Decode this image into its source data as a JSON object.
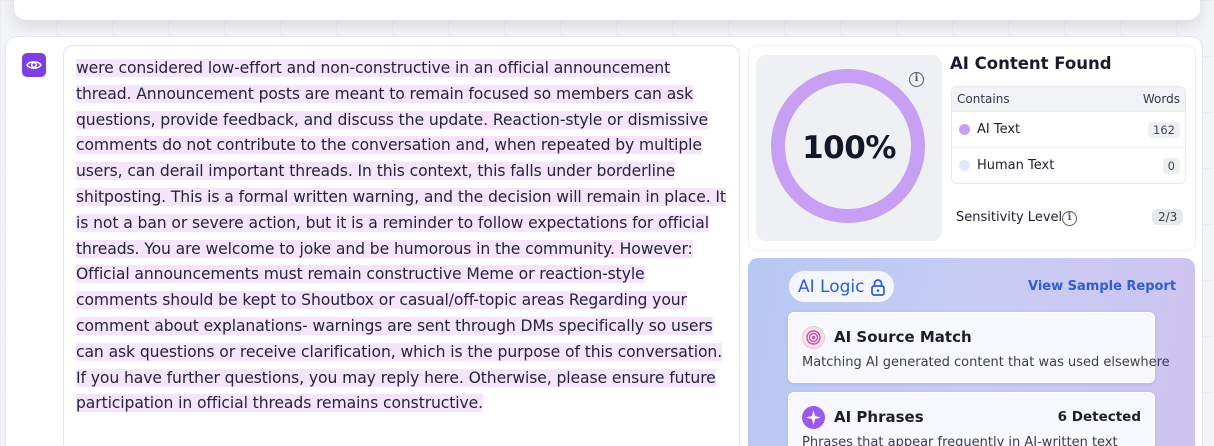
{
  "colors": {
    "accent_purple": "#7b3fe4",
    "ai_text_highlight": "#f5e4fb",
    "ring_ai": "#c7a0f4",
    "human_dot": "#e1e8f9",
    "logic_blue": "#2d5bdc"
  },
  "toolbar": {
    "eye_icon": "eye-icon"
  },
  "document": {
    "text": "were considered low-effort and non-constructive in an official announcement thread. Announcement posts are meant to remain focused so members can ask questions, provide feedback, and discuss the update. Reaction-style or dismissive comments do not contribute to the conversation and, when repeated by multiple users, can derail important threads. In this context, this falls under borderline shitposting. This is a formal written warning, and the decision will remain in place. It is not a ban or severe action, but it is a reminder to follow expectations for official threads. You are welcome to joke and be humorous in the community. However: Official announcements must remain constructive Meme or reaction-style comments should be kept to Shoutbox or casual/off-topic areas Regarding your comment about explanations- warnings are sent through DMs specifically so users can ask questions or receive clarification, which is the purpose of this conversation. If you have further questions, you may reply here. Otherwise, please ensure future participation in official threads remains constructive."
  },
  "result": {
    "percentage": "100%",
    "percentage_value": 100,
    "title": "AI Content Found",
    "table": {
      "col_contains": "Contains",
      "col_words": "Words",
      "rows": [
        {
          "label": "AI Text",
          "count": "162"
        },
        {
          "label": "Human Text",
          "count": "0"
        }
      ]
    },
    "sensitivity_label": "Sensitivity Level",
    "sensitivity_value": "2/3"
  },
  "ai_logic": {
    "title": "AI Logic",
    "sample_link": "View Sample Report",
    "cards": [
      {
        "title": "AI Source Match",
        "description": "Matching AI generated content that was used elsewhere",
        "badge": ""
      },
      {
        "title": "AI Phrases",
        "description": "Phrases that appear frequently in AI-written text",
        "badge": "6 Detected"
      }
    ]
  }
}
